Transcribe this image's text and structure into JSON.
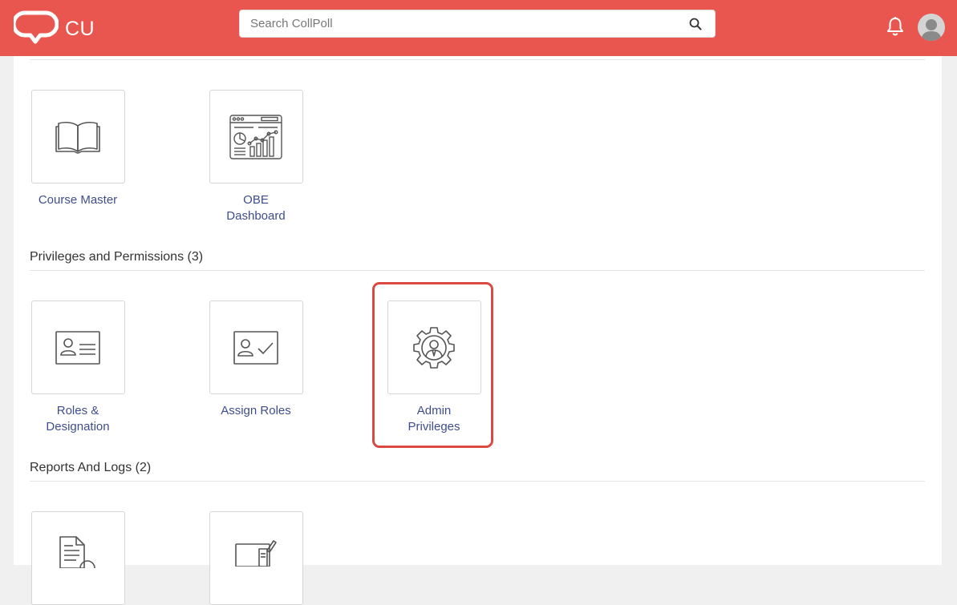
{
  "header": {
    "brand": "CU",
    "search_placeholder": "Search CollPoll",
    "icons": [
      "chat-bubble-logo",
      "search-icon",
      "bell-icon",
      "avatar"
    ],
    "accent_color": "#e8564f"
  },
  "sections": [
    {
      "tiles": [
        {
          "label_lines": [
            "Course Master"
          ],
          "icon": "open-book-icon"
        },
        {
          "label_lines": [
            "OBE",
            "Dashboard"
          ],
          "icon": "dashboard-analytics-icon"
        }
      ]
    },
    {
      "title": "Privileges and Permissions (3)",
      "tiles": [
        {
          "label_lines": [
            "Roles &",
            "Designation"
          ],
          "icon": "id-card-icon"
        },
        {
          "label_lines": [
            "Assign Roles"
          ],
          "icon": "id-card-check-icon"
        },
        {
          "label_lines": [
            "Admin",
            "Privileges"
          ],
          "icon": "gear-person-icon",
          "highlighted": true
        }
      ]
    },
    {
      "title": "Reports And Logs (2)",
      "tiles": [
        {
          "label_lines": [],
          "icon": "document-icon"
        },
        {
          "label_lines": [],
          "icon": "monitor-pen-icon"
        }
      ]
    }
  ]
}
